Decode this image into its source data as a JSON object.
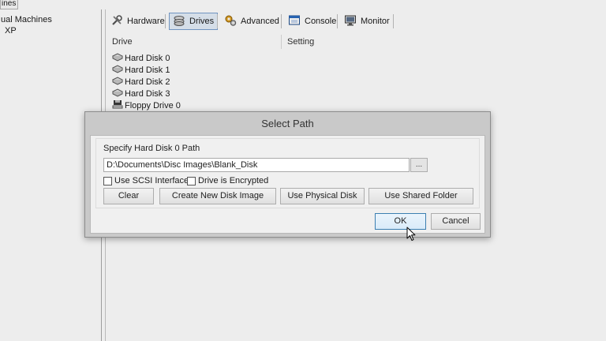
{
  "left_panel": {
    "tab_label": "ines",
    "tree": [
      "ual Machines",
      "XP"
    ]
  },
  "toolbar": {
    "tabs": [
      {
        "label": "Hardware",
        "icon": "hardware-wrench-icon"
      },
      {
        "label": "Drives",
        "icon": "drives-icon",
        "active": true
      },
      {
        "label": "Advanced",
        "icon": "advanced-gears-icon"
      },
      {
        "label": "Console",
        "icon": "console-icon"
      },
      {
        "label": "Monitor",
        "icon": "monitor-icon"
      }
    ]
  },
  "drives": {
    "columns": [
      "Drive",
      "Setting"
    ],
    "rows": [
      {
        "label": "Hard Disk 0",
        "icon": "hard-disk-icon"
      },
      {
        "label": "Hard Disk 1",
        "icon": "hard-disk-icon"
      },
      {
        "label": "Hard Disk 2",
        "icon": "hard-disk-icon"
      },
      {
        "label": "Hard Disk 3",
        "icon": "hard-disk-icon"
      },
      {
        "label": "Floppy Drive 0",
        "icon": "floppy-drive-icon"
      }
    ]
  },
  "dialog": {
    "title": "Select Path",
    "path_label": "Specify Hard Disk 0 Path",
    "path_value": "D:\\Documents\\Disc Images\\Blank_Disk",
    "browse_label": "...",
    "checkboxes": [
      {
        "label": "Use SCSI Interface",
        "checked": false
      },
      {
        "label": "Drive is Encrypted",
        "checked": false
      }
    ],
    "buttons": {
      "clear": "Clear",
      "create": "Create New Disk Image",
      "physical": "Use Physical Disk",
      "shared": "Use Shared Folder",
      "ok": "OK",
      "cancel": "Cancel"
    }
  },
  "colors": {
    "accent": "#3c7fb1",
    "dialog_frame": "#c9c9c9",
    "dialog_body": "#f0f0f0"
  }
}
